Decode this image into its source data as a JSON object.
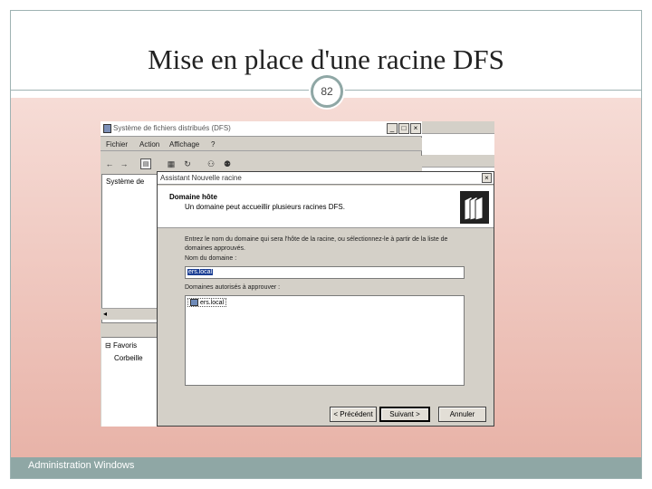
{
  "slide": {
    "title": "Mise en place d'une racine DFS",
    "page_number": "82",
    "footer": "Administration Windows"
  },
  "window": {
    "title": "Système de fichiers distribués (DFS)",
    "menu": [
      "Fichier",
      "Action",
      "Affichage",
      "?"
    ],
    "tree_root": "Système de",
    "tree_lower": [
      "Favoris",
      "Corbeille"
    ]
  },
  "dialog": {
    "title": "Assistant Nouvelle racine",
    "header_title": "Domaine hôte",
    "header_subtitle": "Un domaine peut accueillir plusieurs racines DFS.",
    "instructions": "Entrez le nom du domaine qui sera l'hôte de la racine, ou sélectionnez-le à partir de la liste de domaines approuvés.",
    "domain_label": "Nom du domaine :",
    "domain_value": "ers.local",
    "trusted_label": "Domaines autorisés à approuver :",
    "trusted_domains": [
      "ers.local"
    ],
    "buttons": {
      "back": "< Précédent",
      "next": "Suivant >",
      "cancel": "Annuler"
    }
  },
  "icons": {
    "window": "dfs-icon",
    "dialog_header": "folder-stack-icon",
    "list_item": "network-domain-icon"
  },
  "colors": {
    "accent": "#8fa7a5",
    "selection": "#1c3f94",
    "gradient_top": "#f6dcd6",
    "gradient_bottom": "#e8b3a8"
  }
}
